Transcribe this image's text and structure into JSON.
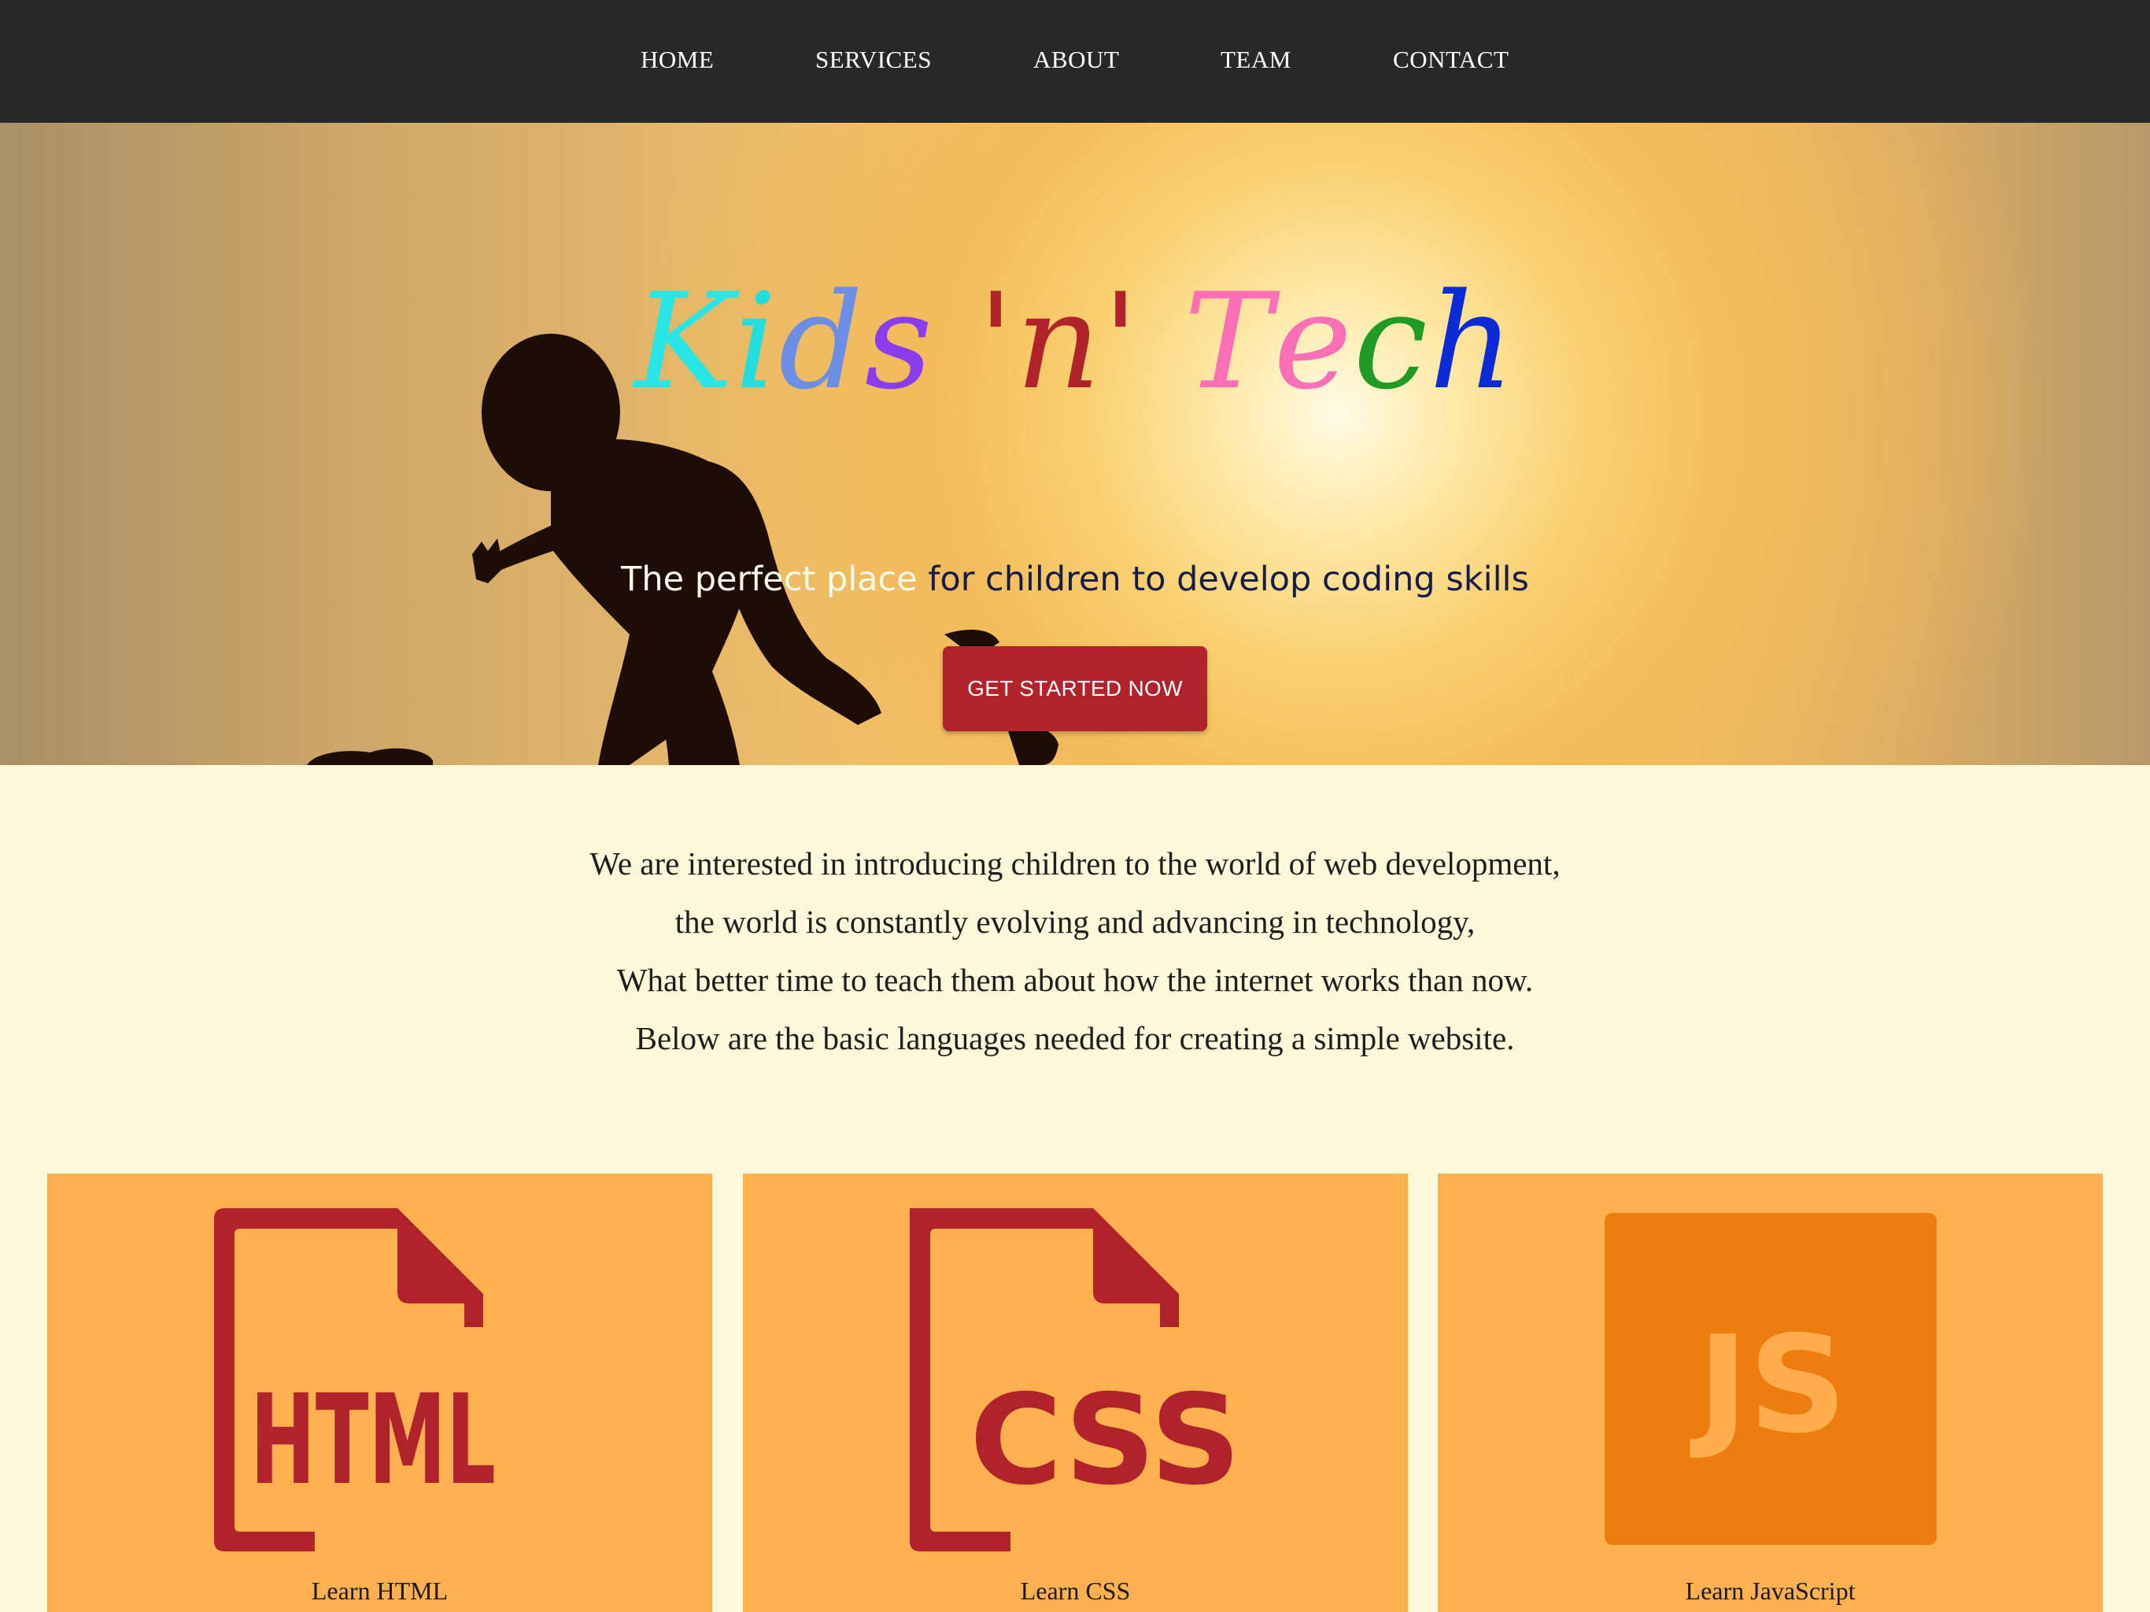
{
  "nav": {
    "items": [
      {
        "label": "HOME"
      },
      {
        "label": "SERVICES"
      },
      {
        "label": "ABOUT"
      },
      {
        "label": "TEAM"
      },
      {
        "label": "CONTACT"
      }
    ]
  },
  "hero": {
    "title_parts": [
      {
        "text": "Kids",
        "colors": [
          "#29e6e6",
          "#22dede",
          "#6c8ee6",
          "#8b3cf0"
        ]
      },
      {
        "text": "'n'",
        "colors": [
          "#b0232a"
        ]
      },
      {
        "text": "Tech",
        "colors": [
          "#ff6fb6",
          "#ff6fb6",
          "#1f9a25",
          "#0a2bd6",
          "#23a6a0"
        ]
      }
    ],
    "title_letters": [
      "K",
      "i",
      "d",
      "s",
      "'",
      "n",
      "'",
      "T",
      "e",
      "c",
      "h"
    ],
    "subtitle_light": "The perfect place",
    "subtitle_dark": " for children to develop coding skills",
    "cta_label": "GET STARTED NOW"
  },
  "intro": {
    "lines": [
      "We are interested in introducing children to the world of web development,",
      "the world is constantly evolving and advancing in technology,",
      "What better time to teach them about how the internet works than now.",
      "Below are the basic languages needed for creating a simple website."
    ]
  },
  "cards": [
    {
      "icon": "html-file-icon",
      "icon_text": "HTML",
      "label": "Learn HTML"
    },
    {
      "icon": "css-file-icon",
      "icon_text": "CSS",
      "label": "Learn CSS"
    },
    {
      "icon": "js-square-icon",
      "icon_text": "JS",
      "label": "Learn JavaScript"
    }
  ],
  "colors": {
    "nav_bg": "#282828",
    "page_bg": "#fff9dc",
    "accent_red": "#b0232a",
    "card_bg": "#ffb14f",
    "js_box": "#ee7d10",
    "js_text": "#ffad4d"
  }
}
